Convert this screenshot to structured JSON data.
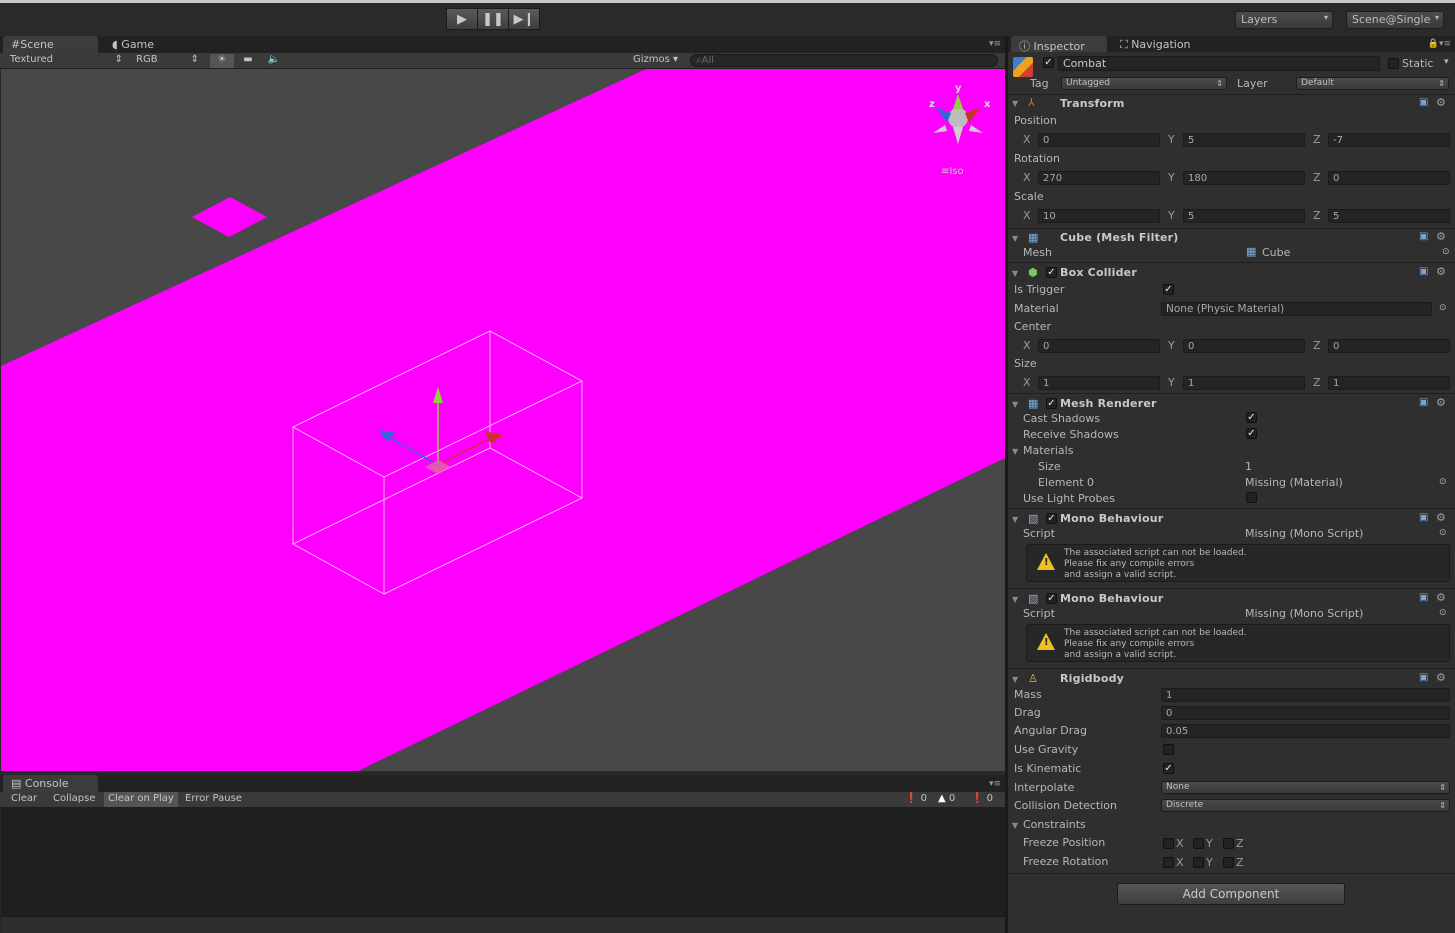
{
  "toolbar": {
    "play_icon": "play-icon",
    "pause_icon": "pause-icon",
    "step_icon": "step-icon",
    "layers_label": "Layers",
    "layout_label": "Scene@Single"
  },
  "scene_tabs": {
    "scene": "Scene",
    "game": "Game"
  },
  "scene_toolbar": {
    "render_mode": "Textured",
    "channel": "RGB",
    "gizmos": "Gizmos",
    "search_placeholder": "All"
  },
  "gizmo": {
    "y": "y",
    "x": "x",
    "z": "z",
    "mode": "Iso"
  },
  "colors": {
    "missing_material": "#ff00ff",
    "scene_bg": "#484848",
    "axis_x": "#c8342c",
    "axis_y": "#8ed042",
    "axis_z": "#3a63d8"
  },
  "console": {
    "tab": "Console",
    "buttons": [
      "Clear",
      "Collapse",
      "Clear on Play",
      "Error Pause"
    ],
    "errors": "0",
    "warnings": "0",
    "messages": "0"
  },
  "inspector_tabs": {
    "inspector": "Inspector",
    "navigation": "Navigation"
  },
  "object": {
    "name": "Combat",
    "static_label": "Static",
    "tag_label": "Tag",
    "tag": "Untagged",
    "layer_label": "Layer",
    "layer": "Default"
  },
  "transform": {
    "title": "Transform",
    "position_label": "Position",
    "position": {
      "x": "0",
      "y": "5",
      "z": "-7"
    },
    "rotation_label": "Rotation",
    "rotation": {
      "x": "270",
      "y": "180",
      "z": "0"
    },
    "scale_label": "Scale",
    "scale": {
      "x": "10",
      "y": "5",
      "z": "5"
    }
  },
  "axes": {
    "x": "X",
    "y": "Y",
    "z": "Z"
  },
  "mesh_filter": {
    "title": "Cube (Mesh Filter)",
    "mesh_label": "Mesh",
    "mesh": "Cube"
  },
  "box_collider": {
    "title": "Box Collider",
    "is_trigger_label": "Is Trigger",
    "material_label": "Material",
    "material": "None (Physic Material)",
    "center_label": "Center",
    "center": {
      "x": "0",
      "y": "0",
      "z": "0"
    },
    "size_label": "Size",
    "size": {
      "x": "1",
      "y": "1",
      "z": "1"
    }
  },
  "mesh_renderer": {
    "title": "Mesh Renderer",
    "cast_shadows": "Cast Shadows",
    "receive_shadows": "Receive Shadows",
    "materials": "Materials",
    "size_label": "Size",
    "size": "1",
    "element0_label": "Element 0",
    "element0": "Missing (Material)",
    "light_probes": "Use Light Probes"
  },
  "mono1": {
    "title": "Mono Behaviour",
    "script_label": "Script",
    "script": "Missing (Mono Script)",
    "warn1": "The associated script can not be loaded.",
    "warn2": "Please fix any compile errors",
    "warn3": "and assign a valid script."
  },
  "mono2": {
    "title": "Mono Behaviour",
    "script_label": "Script",
    "script": "Missing (Mono Script)",
    "warn1": "The associated script can not be loaded.",
    "warn2": "Please fix any compile errors",
    "warn3": "and assign a valid script."
  },
  "rigidbody": {
    "title": "Rigidbody",
    "mass_label": "Mass",
    "mass": "1",
    "drag_label": "Drag",
    "drag": "0",
    "angular_label": "Angular Drag",
    "angular": "0.05",
    "gravity_label": "Use Gravity",
    "kinematic_label": "Is Kinematic",
    "interpolate_label": "Interpolate",
    "interpolate": "None",
    "collision_label": "Collision Detection",
    "collision": "Discrete",
    "constraints_label": "Constraints",
    "freeze_pos_label": "Freeze Position",
    "freeze_rot_label": "Freeze Rotation"
  },
  "add_component": "Add Component"
}
